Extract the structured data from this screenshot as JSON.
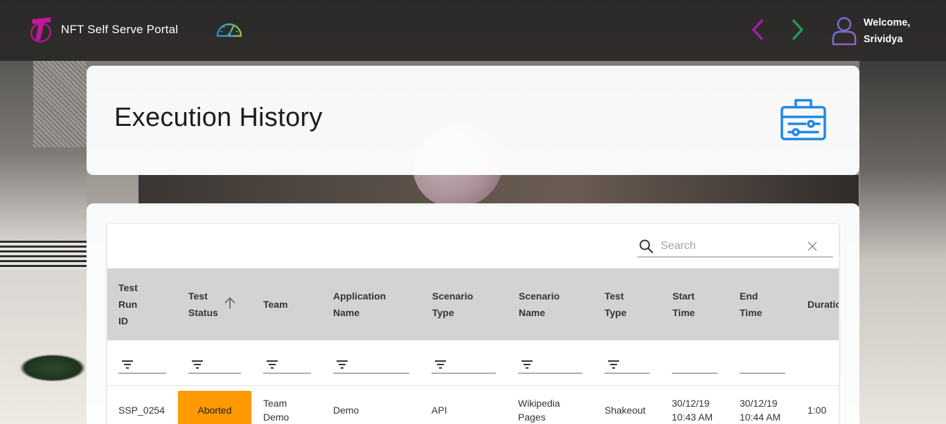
{
  "app": {
    "title": "NFT Self Serve Portal",
    "welcome_line1": "Welcome,",
    "welcome_line2": "Srividya"
  },
  "icons": {
    "brand": "telstra-logo-icon",
    "dashboard": "speedometer-icon",
    "back": "chevron-left-icon",
    "forward": "chevron-right-icon",
    "user": "user-icon",
    "page": "toolbox-icon",
    "search": "search-icon",
    "clear": "close-icon",
    "sort": "arrow-up-icon",
    "filter": "filter-icon"
  },
  "colors": {
    "brand_magenta": "#b0198c",
    "accent_blue": "#1e88e5",
    "nav_back": "#a21caf",
    "nav_forward": "#1f9d55",
    "status_aborted": "#ff9900",
    "header_bg": "#d3d3d3"
  },
  "page": {
    "title": "Execution History"
  },
  "search": {
    "placeholder": "Search",
    "value": ""
  },
  "table": {
    "columns": [
      {
        "key": "test_run_id",
        "label": [
          "Test",
          "Run",
          "ID"
        ]
      },
      {
        "key": "test_status",
        "label": [
          "Test",
          "Status"
        ],
        "sorted": "asc"
      },
      {
        "key": "team",
        "label": [
          "Team"
        ]
      },
      {
        "key": "application_name",
        "label": [
          "Application",
          "Name"
        ]
      },
      {
        "key": "scenario_type",
        "label": [
          "Scenario",
          "Type"
        ]
      },
      {
        "key": "scenario_name",
        "label": [
          "Scenario",
          "Name"
        ]
      },
      {
        "key": "test_type",
        "label": [
          "Test",
          "Type"
        ]
      },
      {
        "key": "start_time",
        "label": [
          "Start",
          "Time"
        ]
      },
      {
        "key": "end_time",
        "label": [
          "End",
          "Time"
        ]
      },
      {
        "key": "duration",
        "label": [
          "Duratio"
        ]
      }
    ],
    "rows": [
      {
        "test_run_id": "SSP_0254",
        "test_status": "Aborted",
        "team": [
          "Team",
          "Demo"
        ],
        "application_name": "Demo",
        "scenario_type": "API",
        "scenario_name": [
          "Wikipedia",
          "Pages"
        ],
        "test_type": "Shakeout",
        "start_time": [
          "30/12/19",
          "10:43 AM"
        ],
        "end_time": [
          "30/12/19",
          "10:44 AM"
        ],
        "duration": "1:00"
      }
    ]
  }
}
